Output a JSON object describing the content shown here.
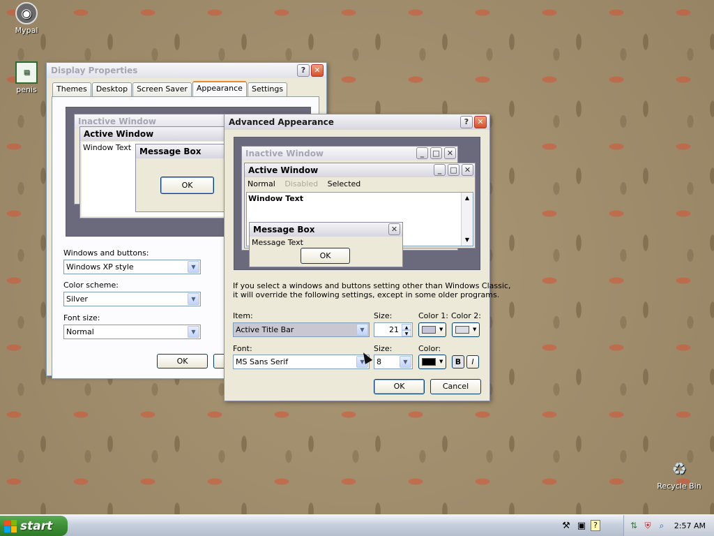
{
  "desktop": {
    "icons": [
      {
        "label": "Mypal"
      },
      {
        "label": "penis"
      },
      {
        "label": "Recycle Bin"
      }
    ]
  },
  "display_properties": {
    "title": "Display Properties",
    "tabs": [
      "Themes",
      "Desktop",
      "Screen Saver",
      "Appearance",
      "Settings"
    ],
    "selected_tab": "Appearance",
    "preview": {
      "inactive_title": "Inactive Window",
      "active_title": "Active Window",
      "window_text": "Window Text",
      "message_box_title": "Message Box",
      "ok": "OK"
    },
    "windows_buttons_label": "Windows and buttons:",
    "windows_buttons_value": "Windows XP style",
    "color_scheme_label": "Color scheme:",
    "color_scheme_value": "Silver",
    "font_size_label": "Font size:",
    "font_size_value": "Normal",
    "ok": "OK"
  },
  "advanced_appearance": {
    "title": "Advanced Appearance",
    "preview": {
      "inactive_title": "Inactive Window",
      "active_title": "Active Window",
      "menu_normal": "Normal",
      "menu_disabled": "Disabled",
      "menu_selected": "Selected",
      "window_text": "Window Text",
      "message_box_title": "Message Box",
      "message_text": "Message Text",
      "ok": "OK"
    },
    "info_line1": "If you select a windows and buttons setting other than Windows Classic,",
    "info_line2": "it will override the following settings, except in some older programs.",
    "item_label": "Item:",
    "item_value": "Active Title Bar",
    "size_label": "Size:",
    "size_value": "21",
    "color1_label": "Color 1:",
    "color2_label": "Color 2:",
    "font_label": "Font:",
    "font_value": "MS Sans Serif",
    "font_size_label": "Size:",
    "font_size_value": "8",
    "color_label": "Color:",
    "bold": "B",
    "italic": "I",
    "ok": "OK",
    "cancel": "Cancel"
  },
  "taskbar": {
    "start_label": "start",
    "clock": "2:57 AM"
  }
}
